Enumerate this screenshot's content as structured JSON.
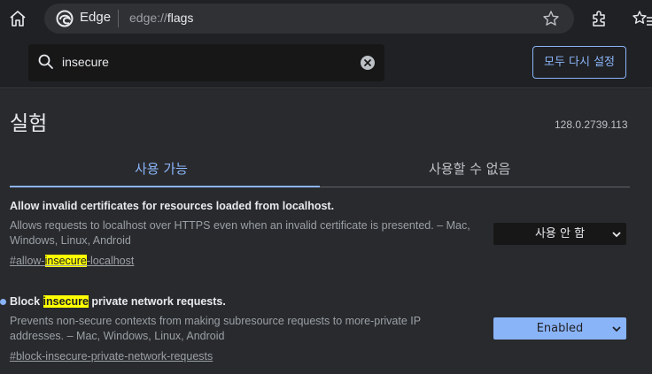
{
  "browser": {
    "origin_label": "Edge",
    "url_prefix": "edge://",
    "url_path": "flags"
  },
  "search": {
    "value": "insecure"
  },
  "reset_button": "모두 다시 설정",
  "page": {
    "title": "실험",
    "version": "128.0.2739.113"
  },
  "tabs": [
    {
      "label": "사용 가능",
      "active": true
    },
    {
      "label": "사용할 수 없음",
      "active": false
    }
  ],
  "experiments": [
    {
      "name_pre": "Allow invalid certificates for resources loaded from localhost.",
      "name_hl": "",
      "name_post": "",
      "description": "Allows requests to localhost over HTTPS even when an invalid certificate is presented. – Mac, Windows, Linux, Android",
      "link_pre": "#allow-",
      "link_hl": "insecure",
      "link_post": "-localhost",
      "select_value": "사용 안 함"
    },
    {
      "name_pre": "Block ",
      "name_hl": "insecure",
      "name_post": " private network requests.",
      "description": "Prevents non-secure contexts from making subresource requests to more-private IP addresses. – Mac, Windows, Linux, Android",
      "link_pre": "#block-insecure-private-network-requests",
      "link_hl": "",
      "link_post": "",
      "select_value": "Enabled"
    }
  ],
  "colors": {
    "accent": "#8ab4f8",
    "highlight": "#ffff00",
    "background": "#292a2d"
  }
}
